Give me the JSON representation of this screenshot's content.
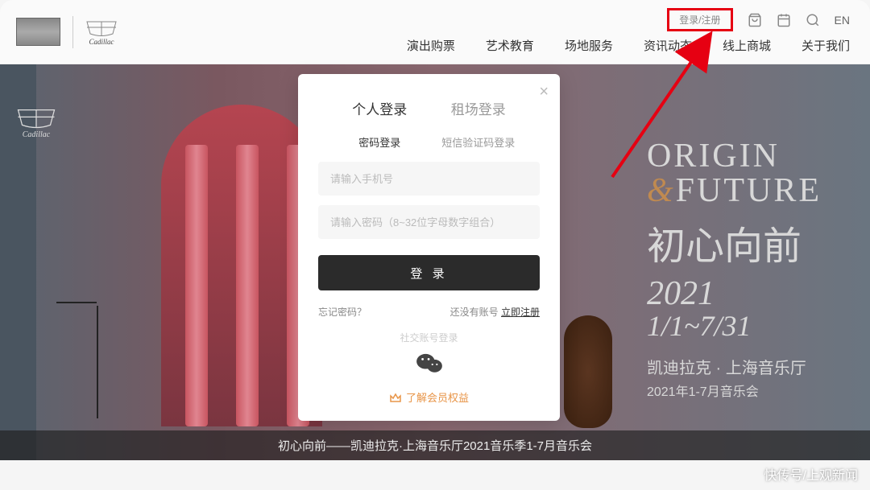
{
  "header": {
    "brand_text": "Cadillac",
    "login_register": "登录/注册",
    "lang": "EN"
  },
  "nav": {
    "items": [
      "演出购票",
      "艺术教育",
      "场地服务",
      "资讯动态",
      "线上商城",
      "关于我们"
    ]
  },
  "hero": {
    "title_en1": "ORIGIN",
    "title_amp": "&",
    "title_en2": "FUTURE",
    "title_cn": "初心向前",
    "year": "2021",
    "dates": "1/1~7/31",
    "subtitle1": "凯迪拉克 · 上海音乐厅",
    "subtitle2": "2021年1-7月音乐会",
    "caption": "初心向前——凯迪拉克·上海音乐厅2021音乐季1-7月音乐会"
  },
  "modal": {
    "tab_personal": "个人登录",
    "tab_venue": "租场登录",
    "subtab_password": "密码登录",
    "subtab_sms": "短信验证码登录",
    "phone_placeholder": "请输入手机号",
    "password_placeholder": "请输入密码（8~32位字母数字组合）",
    "login_button": "登 录",
    "forgot_password": "忘记密码？",
    "no_account_prefix": "还没有账号 ",
    "register_now": "立即注册",
    "social_login_label": "社交账号登录",
    "member_benefits": "了解会员权益"
  },
  "watermark": "快传号/上观新闻"
}
